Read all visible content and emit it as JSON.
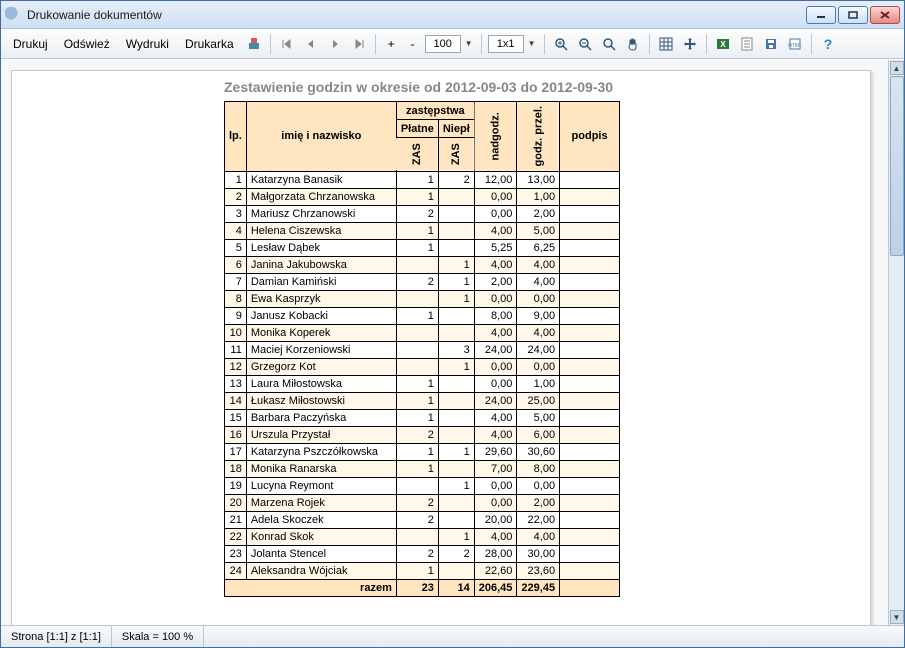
{
  "window": {
    "title": "Drukowanie dokumentów"
  },
  "toolbar": {
    "print": "Drukuj",
    "refresh": "Odśwież",
    "printouts": "Wydruki",
    "printer": "Drukarka",
    "zoom_value": "100",
    "grid_value": "1x1",
    "minus": "-",
    "plus": "+"
  },
  "statusbar": {
    "page": "Strona [1:1] z [1:1]",
    "scale": "Skala = 100 %"
  },
  "report": {
    "title": "Zestawienie godzin w okresie od 2012-09-03 do 2012-09-30",
    "headers": {
      "lp": "lp.",
      "name": "imię i nazwisko",
      "sub": "zastępstwa",
      "paid": "Płatne",
      "unpaid": "Niepł",
      "zas": "ZAS",
      "over": "nadgodz.",
      "assigned": "godz. przel.",
      "sign": "podpis"
    },
    "total_label": "razem",
    "totals": {
      "zas_p": "23",
      "zas_n": "14",
      "over": "206,45",
      "assigned": "229,45"
    },
    "rows": [
      {
        "lp": "1",
        "name": "Katarzyna Banasik",
        "zas_p": "1",
        "zas_n": "2",
        "over": "12,00",
        "assigned": "13,00"
      },
      {
        "lp": "2",
        "name": "Małgorzata Chrzanowska",
        "zas_p": "1",
        "zas_n": "",
        "over": "0,00",
        "assigned": "1,00"
      },
      {
        "lp": "3",
        "name": "Mariusz Chrzanowski",
        "zas_p": "2",
        "zas_n": "",
        "over": "0,00",
        "assigned": "2,00"
      },
      {
        "lp": "4",
        "name": "Helena Ciszewska",
        "zas_p": "1",
        "zas_n": "",
        "over": "4,00",
        "assigned": "5,00"
      },
      {
        "lp": "5",
        "name": "Lesław Dąbek",
        "zas_p": "1",
        "zas_n": "",
        "over": "5,25",
        "assigned": "6,25"
      },
      {
        "lp": "6",
        "name": "Janina Jakubowska",
        "zas_p": "",
        "zas_n": "1",
        "over": "4,00",
        "assigned": "4,00"
      },
      {
        "lp": "7",
        "name": "Damian Kamiński",
        "zas_p": "2",
        "zas_n": "1",
        "over": "2,00",
        "assigned": "4,00"
      },
      {
        "lp": "8",
        "name": "Ewa Kasprzyk",
        "zas_p": "",
        "zas_n": "1",
        "over": "0,00",
        "assigned": "0,00"
      },
      {
        "lp": "9",
        "name": "Janusz Kobacki",
        "zas_p": "1",
        "zas_n": "",
        "over": "8,00",
        "assigned": "9,00"
      },
      {
        "lp": "10",
        "name": "Monika Koperek",
        "zas_p": "",
        "zas_n": "",
        "over": "4,00",
        "assigned": "4,00"
      },
      {
        "lp": "11",
        "name": "Maciej Korzeniowski",
        "zas_p": "",
        "zas_n": "3",
        "over": "24,00",
        "assigned": "24,00"
      },
      {
        "lp": "12",
        "name": "Grzegorz Kot",
        "zas_p": "",
        "zas_n": "1",
        "over": "0,00",
        "assigned": "0,00"
      },
      {
        "lp": "13",
        "name": "Laura Miłostowska",
        "zas_p": "1",
        "zas_n": "",
        "over": "0,00",
        "assigned": "1,00"
      },
      {
        "lp": "14",
        "name": "Łukasz Miłostowski",
        "zas_p": "1",
        "zas_n": "",
        "over": "24,00",
        "assigned": "25,00"
      },
      {
        "lp": "15",
        "name": "Barbara Paczyńska",
        "zas_p": "1",
        "zas_n": "",
        "over": "4,00",
        "assigned": "5,00"
      },
      {
        "lp": "16",
        "name": "Urszula Przystał",
        "zas_p": "2",
        "zas_n": "",
        "over": "4,00",
        "assigned": "6,00"
      },
      {
        "lp": "17",
        "name": "Katarzyna Pszczółkowska",
        "zas_p": "1",
        "zas_n": "1",
        "over": "29,60",
        "assigned": "30,60"
      },
      {
        "lp": "18",
        "name": "Monika Ranarska",
        "zas_p": "1",
        "zas_n": "",
        "over": "7,00",
        "assigned": "8,00"
      },
      {
        "lp": "19",
        "name": "Lucyna Reymont",
        "zas_p": "",
        "zas_n": "1",
        "over": "0,00",
        "assigned": "0,00"
      },
      {
        "lp": "20",
        "name": "Marzena Rojek",
        "zas_p": "2",
        "zas_n": "",
        "over": "0,00",
        "assigned": "2,00"
      },
      {
        "lp": "21",
        "name": "Adela Skoczek",
        "zas_p": "2",
        "zas_n": "",
        "over": "20,00",
        "assigned": "22,00"
      },
      {
        "lp": "22",
        "name": "Konrad Skok",
        "zas_p": "",
        "zas_n": "1",
        "over": "4,00",
        "assigned": "4,00"
      },
      {
        "lp": "23",
        "name": "Jolanta Stencel",
        "zas_p": "2",
        "zas_n": "2",
        "over": "28,00",
        "assigned": "30,00"
      },
      {
        "lp": "24",
        "name": "Aleksandra Wójciak",
        "zas_p": "1",
        "zas_n": "",
        "over": "22,60",
        "assigned": "23,60"
      }
    ]
  }
}
